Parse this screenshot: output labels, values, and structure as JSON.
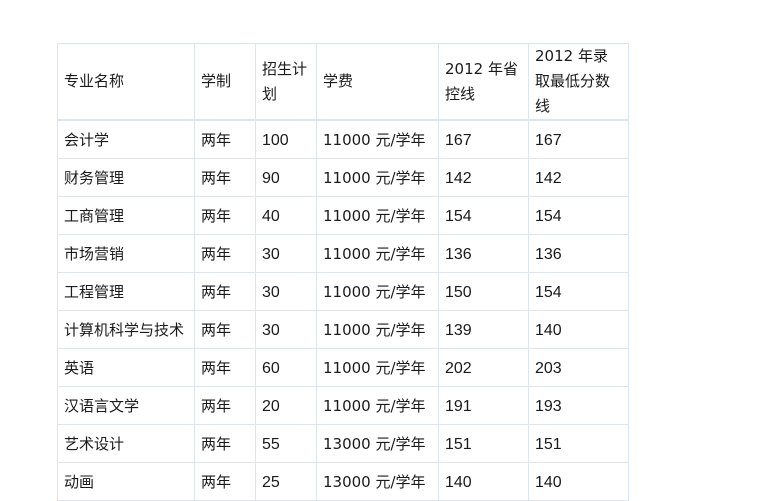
{
  "table": {
    "headers": [
      "专业名称",
      "学制",
      "招生计划",
      "学费",
      "2012 年省控线",
      "2012 年录取最低分数线"
    ],
    "rows": [
      [
        "会计学",
        "两年",
        "100",
        "11000 元/学年",
        "167",
        "167"
      ],
      [
        "财务管理",
        "两年",
        "90",
        "11000 元/学年",
        "142",
        "142"
      ],
      [
        "工商管理",
        "两年",
        "40",
        "11000 元/学年",
        "154",
        "154"
      ],
      [
        "市场营销",
        "两年",
        "30",
        "11000 元/学年",
        "136",
        "136"
      ],
      [
        "工程管理",
        "两年",
        "30",
        "11000 元/学年",
        "150",
        "154"
      ],
      [
        "计算机科学与技术",
        "两年",
        "30",
        "11000 元/学年",
        "139",
        "140"
      ],
      [
        "英语",
        "两年",
        "60",
        "11000 元/学年",
        "202",
        "203"
      ],
      [
        "汉语言文学",
        "两年",
        "20",
        "11000 元/学年",
        "191",
        "193"
      ],
      [
        "艺术设计",
        "两年",
        "55",
        "13000 元/学年",
        "151",
        "151"
      ],
      [
        "动画",
        "两年",
        "25",
        "13000 元/学年",
        "140",
        "140"
      ]
    ]
  }
}
